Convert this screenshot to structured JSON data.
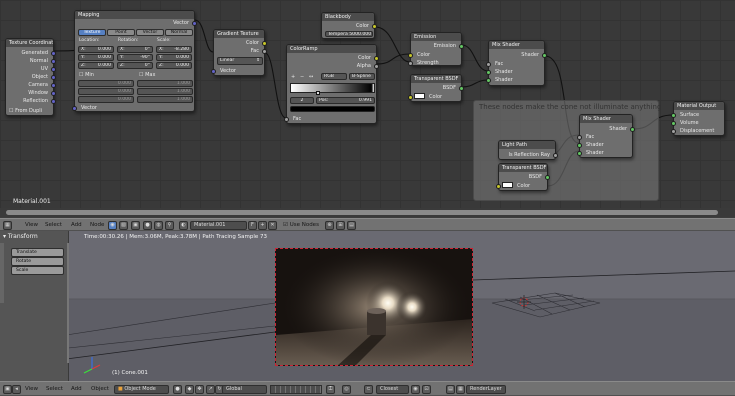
{
  "node_editor": {
    "material_label": "Material.001",
    "frame_label": "These nodes make the cone not illuminate anything",
    "nodes": {
      "texcoord": {
        "title": "Texture Coordinate",
        "outputs": [
          "Generated",
          "Normal",
          "UV",
          "Object",
          "Camera",
          "Window",
          "Reflection"
        ],
        "from_dupli": "From Dupli"
      },
      "mapping": {
        "title": "Mapping",
        "out": "Vector",
        "tabs": [
          "Texture",
          "Point",
          "Vector",
          "Normal"
        ],
        "col_headers": [
          "Location:",
          "Rotation:",
          "Scale:"
        ],
        "loc": [
          "X:",
          "0.000",
          "Y:",
          "0.000",
          "Z:",
          "0.000"
        ],
        "rot": [
          "X:",
          "0°",
          "Y:",
          "-90°",
          "Z:",
          "0°"
        ],
        "scale": [
          "X:",
          "-8.280",
          "Y:",
          "0.000",
          "Z:",
          "0.000"
        ],
        "min": "Min",
        "max": "Max",
        "min_vals": [
          "0.000",
          "0.000",
          "0.000"
        ],
        "max_vals": [
          "1.000",
          "1.000",
          "1.000"
        ],
        "in": "Vector"
      },
      "gradient": {
        "title": "Gradient Texture",
        "outputs": [
          "Color",
          "Fac"
        ],
        "mode": "Linear",
        "in": "Vector"
      },
      "colorramp": {
        "title": "ColorRamp",
        "outputs": [
          "Color",
          "Alpha"
        ],
        "mode": "RGB",
        "interp": "B-Spline",
        "index": "2",
        "pos": "Pos:",
        "pos_val": "0.991",
        "in": "Fac"
      },
      "blackbody": {
        "title": "Blackbody",
        "out": "Color",
        "field": "Tempera 5000.000"
      },
      "emission": {
        "title": "Emission",
        "out": "Emission",
        "inputs": [
          "Color",
          "Strength"
        ]
      },
      "transparent1": {
        "title": "Transparent BSDF",
        "out": "BSDF",
        "in": "Color"
      },
      "mix1": {
        "title": "Mix Shader",
        "out": "Shader",
        "inputs": [
          "Fac",
          "Shader",
          "Shader"
        ]
      },
      "lightpath": {
        "title": "Light Path",
        "out": "Is Reflection Ray"
      },
      "transparent2": {
        "title": "Transparent BSDF",
        "out": "BSDF",
        "in": "Color"
      },
      "mix2": {
        "title": "Mix Shader",
        "out": "Shader",
        "inputs": [
          "Fac",
          "Shader",
          "Shader"
        ]
      },
      "output": {
        "title": "Material Output",
        "inputs": [
          "Surface",
          "Volume",
          "Displacement"
        ]
      }
    }
  },
  "node_header": {
    "menus": [
      "View",
      "Select",
      "Add",
      "Node"
    ],
    "material": "Material.001",
    "use_nodes": "Use Nodes"
  },
  "viewport": {
    "panel_title": "Transform",
    "tools": [
      "Translate",
      "Rotate",
      "Scale"
    ],
    "status": "Time:00:30.26 | Mem:3.06M, Peak:3.78M | Path Tracing Sample 73",
    "object_label": "(1) Cone.001"
  },
  "view3d_header": {
    "menus": [
      "View",
      "Select",
      "Add",
      "Object"
    ],
    "mode": "Object Mode",
    "orientation": "Global",
    "snap": "Closest",
    "layer": "RenderLayer"
  },
  "colors": {
    "accent": "#5680c2",
    "vector_socket": "#6363c7",
    "color_socket": "#c7c729",
    "shader_socket": "#63c763",
    "selection": "#c23"
  }
}
